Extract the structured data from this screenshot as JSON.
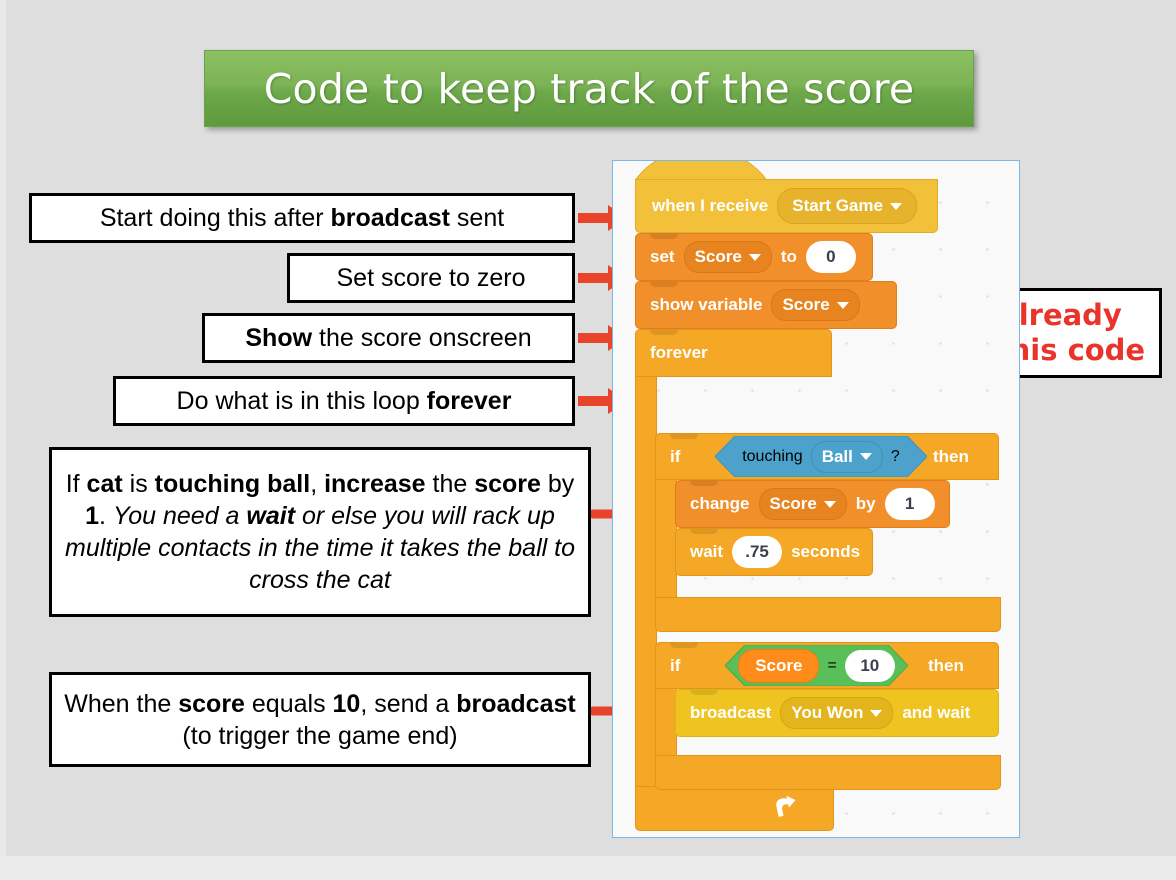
{
  "slide": {
    "title": "Code to keep track of the score",
    "background_color": "#dedede",
    "title_color": "#7cb356"
  },
  "callouts": [
    {
      "id": "c1",
      "segments": [
        {
          "text": "Start doing this after ",
          "style": "normal"
        },
        {
          "text": "broadcast",
          "style": "bold"
        },
        {
          "text": " sent",
          "style": "normal"
        }
      ]
    },
    {
      "id": "c2",
      "segments": [
        {
          "text": "Set score to zero",
          "style": "normal"
        }
      ]
    },
    {
      "id": "c3",
      "segments": [
        {
          "text": "Show",
          "style": "bold"
        },
        {
          "text": " the score onscreen",
          "style": "normal"
        }
      ]
    },
    {
      "id": "c4",
      "segments": [
        {
          "text": "Do what is in this loop ",
          "style": "normal"
        },
        {
          "text": "forever",
          "style": "bold"
        }
      ]
    },
    {
      "id": "c5",
      "segments": [
        {
          "text": "If ",
          "style": "normal"
        },
        {
          "text": "cat",
          "style": "bold"
        },
        {
          "text": " is ",
          "style": "normal"
        },
        {
          "text": "touching ball",
          "style": "bold"
        },
        {
          "text": ", ",
          "style": "normal"
        },
        {
          "text": "increase",
          "style": "bold"
        },
        {
          "text": " the ",
          "style": "normal"
        },
        {
          "text": "score",
          "style": "bold"
        },
        {
          "text": " by ",
          "style": "normal"
        },
        {
          "text": "1",
          "style": "bold"
        },
        {
          "text": ". ",
          "style": "normal"
        },
        {
          "text": "You need a ",
          "style": "italic"
        },
        {
          "text": "wait",
          "style": "bolditalic"
        },
        {
          "text": " or else you will rack up multiple contacts in the time it takes the ball to cross the cat",
          "style": "italic"
        }
      ]
    },
    {
      "id": "c6",
      "segments": [
        {
          "text": "When the ",
          "style": "normal"
        },
        {
          "text": "score",
          "style": "bold"
        },
        {
          "text": " equals ",
          "style": "normal"
        },
        {
          "text": "10",
          "style": "bold"
        },
        {
          "text": ", send a ",
          "style": "normal"
        },
        {
          "text": "broadcast",
          "style": "bold"
        },
        {
          "text": " (to trigger the game end)",
          "style": "normal"
        }
      ]
    }
  ],
  "note_box": {
    "line1": "You already",
    "line2": "have this code",
    "color": "#e8342a"
  },
  "script": {
    "hat": {
      "label": "when I receive",
      "dropdown": "Start Game"
    },
    "set": {
      "label": "set",
      "variable": "Score",
      "to_label": "to",
      "value": "0"
    },
    "show": {
      "label": "show variable",
      "variable": "Score"
    },
    "forever": {
      "label": "forever",
      "loop_icon": "loop-arrow-icon"
    },
    "if1": {
      "if_label": "if",
      "then_label": "then",
      "condition": {
        "label": "touching",
        "dropdown": "Ball",
        "suffix": "?"
      },
      "change": {
        "label": "change",
        "variable": "Score",
        "by_label": "by",
        "value": "1"
      },
      "wait": {
        "label": "wait",
        "value": ".75",
        "unit": "seconds"
      }
    },
    "if2": {
      "if_label": "if",
      "then_label": "then",
      "condition": {
        "left": "Score",
        "operator": "=",
        "right": "10"
      },
      "broadcast": {
        "label": "broadcast",
        "dropdown": "You Won",
        "suffix": "and wait"
      }
    }
  },
  "colors": {
    "events": "#f3c03a",
    "events_alt": "#f0c420",
    "data": "#f18f2b",
    "control": "#f5a726",
    "sensing": "#4da2cc",
    "operators": "#59c059",
    "variable": "#ff8c1a",
    "arrow_red": "#e8442c"
  }
}
